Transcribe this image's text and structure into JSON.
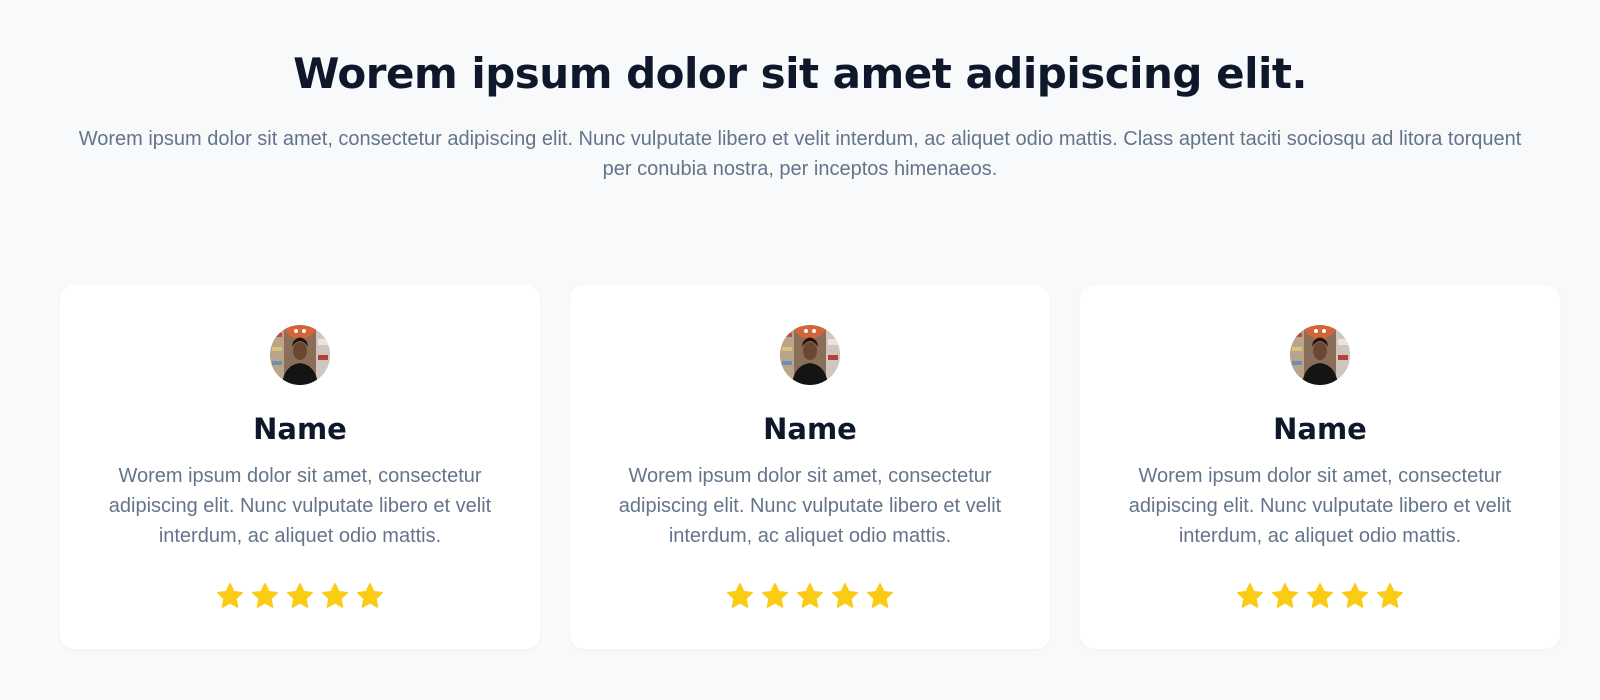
{
  "header": {
    "title": "Worem ipsum dolor sit amet adipiscing elit.",
    "subtitle": "Worem ipsum dolor sit amet, consectetur adipiscing elit. Nunc vulputate libero et velit interdum, ac aliquet odio mattis. Class aptent taciti sociosqu ad litora torquent per conubia nostra, per inceptos himenaeos."
  },
  "colors": {
    "background": "#f8f9fb",
    "card": "#ffffff",
    "heading": "#0f172a",
    "body_text": "#64748b",
    "star": "#facc15"
  },
  "testimonials": [
    {
      "avatar_icon": "user-avatar-photo",
      "name": "Name",
      "text": "Worem ipsum dolor sit amet, consectetur adipiscing elit. Nunc vulputate libero et velit interdum, ac aliquet odio mattis.",
      "rating": 5,
      "rating_max": 5,
      "star_icon": "star-icon"
    },
    {
      "avatar_icon": "user-avatar-photo",
      "name": "Name",
      "text": "Worem ipsum dolor sit amet, consectetur adipiscing elit. Nunc vulputate libero et velit interdum, ac aliquet odio mattis.",
      "rating": 5,
      "rating_max": 5,
      "star_icon": "star-icon"
    },
    {
      "avatar_icon": "user-avatar-photo",
      "name": "Name",
      "text": "Worem ipsum dolor sit amet, consectetur adipiscing elit. Nunc vulputate libero et velit interdum, ac aliquet odio mattis.",
      "rating": 5,
      "rating_max": 5,
      "star_icon": "star-icon"
    }
  ]
}
